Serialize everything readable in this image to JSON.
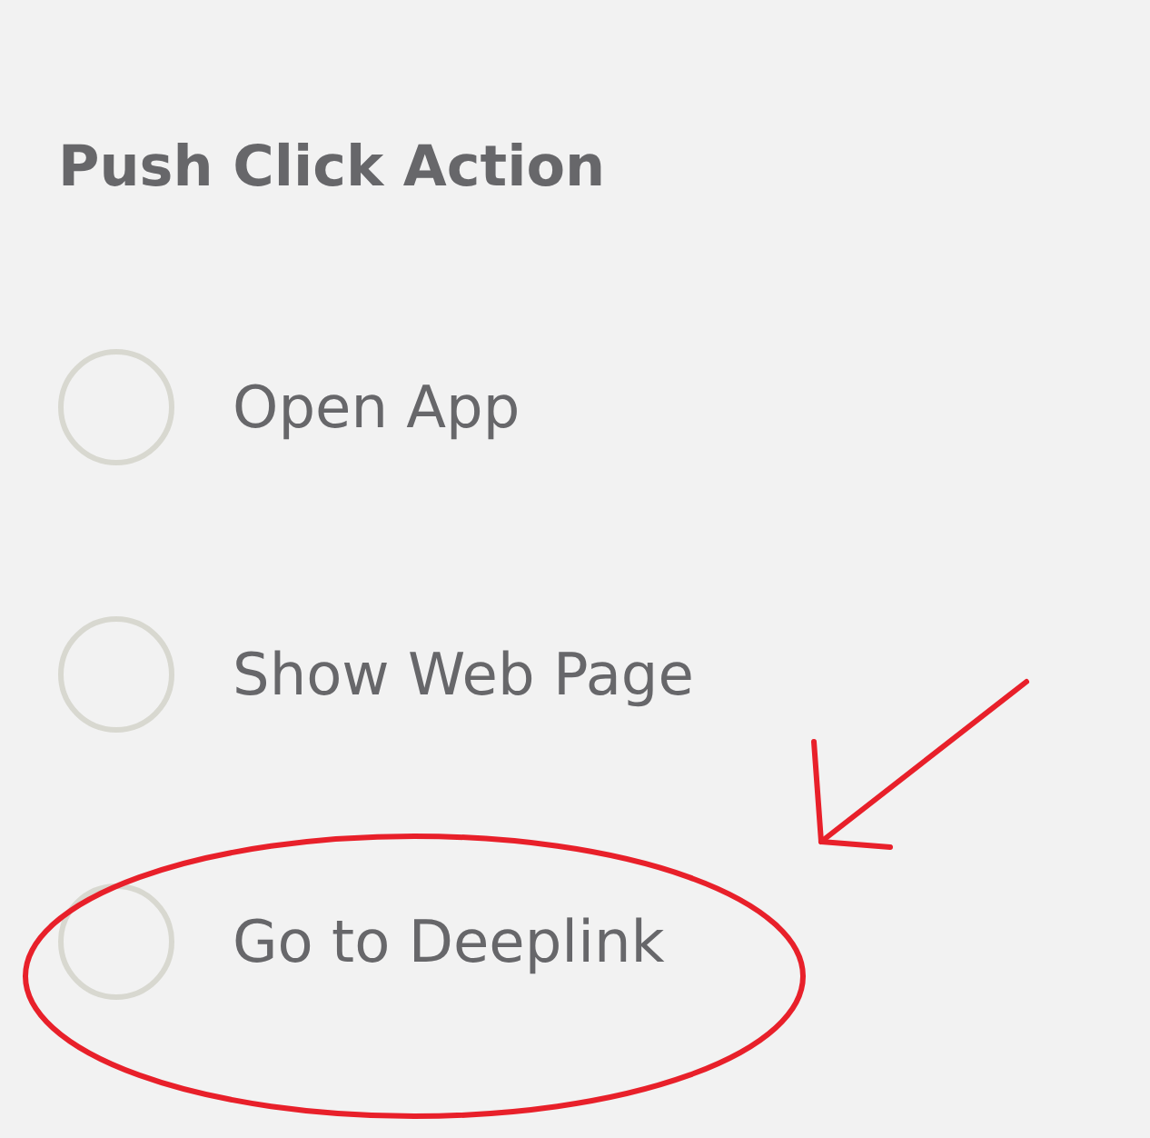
{
  "title": "Push Click Action",
  "options": [
    {
      "label": "Open App",
      "selected": false
    },
    {
      "label": "Show Web Page",
      "selected": false
    },
    {
      "label": "Go to Deeplink",
      "selected": false
    }
  ]
}
